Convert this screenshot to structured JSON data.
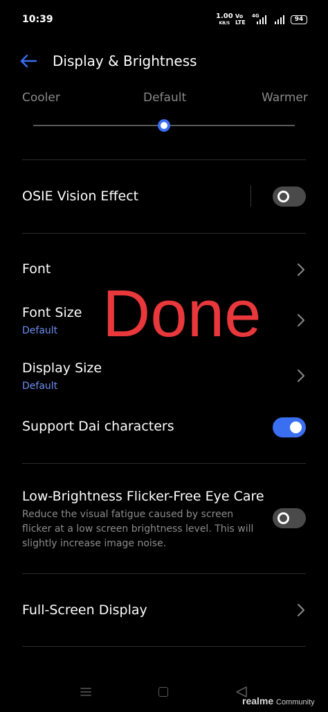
{
  "status_bar": {
    "time": "10:39",
    "net_speed": "1.00",
    "net_speed_unit": "KB/S",
    "volte_top": "Vo",
    "volte_bottom": "LTE",
    "network_type": "4G",
    "battery": "94"
  },
  "header": {
    "title": "Display & Brightness"
  },
  "color_temperature": {
    "cooler_label": "Cooler",
    "default_label": "Default",
    "warmer_label": "Warmer",
    "value_fraction": 0.5
  },
  "settings": {
    "osie": {
      "title": "OSIE Vision Effect",
      "enabled": false
    },
    "font": {
      "title": "Font"
    },
    "font_size": {
      "title": "Font Size",
      "value": "Default"
    },
    "display_size": {
      "title": "Display Size",
      "value": "Default"
    },
    "dai": {
      "title": "Support Dai characters",
      "enabled": true
    },
    "eye_care": {
      "title": "Low-Brightness Flicker-Free Eye Care",
      "description": "Reduce the visual fatigue caused by screen flicker at a low screen brightness level. This will slightly increase image noise.",
      "enabled": false
    },
    "full_screen": {
      "title": "Full-Screen Display"
    }
  },
  "overlay": {
    "text": "Done",
    "color": "#e8383b"
  },
  "watermark": {
    "brand": "realme",
    "suffix": "Community"
  },
  "colors": {
    "accent": "#3a6ff2",
    "subtext": "#6f8ff2",
    "background": "#000000"
  }
}
